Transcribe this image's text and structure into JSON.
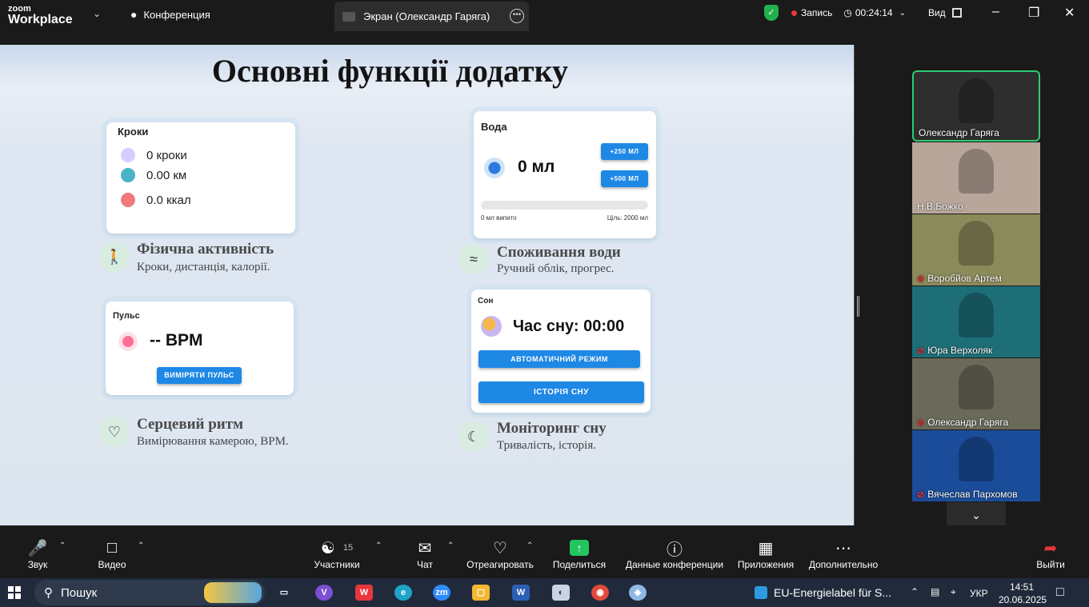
{
  "app": {
    "logo_top": "zoom",
    "logo_bottom": "Workplace"
  },
  "topbar": {
    "tab1": "Конференция",
    "tab2": "Экран (Олександр Гаряга)",
    "record_label": "Запись",
    "timer": "00:24:14",
    "view_label": "Вид"
  },
  "slide": {
    "title": "Основні функції додатку",
    "steps_card": {
      "title": "Кроки",
      "rows": [
        "0 кроки",
        "0.00 км",
        "0.0 ккал"
      ]
    },
    "water_card": {
      "title": "Вода",
      "amount": "0 мл",
      "btn1": "+250 МЛ",
      "btn2": "+500 МЛ",
      "drunk": "0 мл випито",
      "goal": "Ціль: 2000 мл",
      "progress": 0
    },
    "pulse_card": {
      "title": "Пульс",
      "bpm": "-- BPM",
      "button": "ВИМІРЯТИ ПУЛЬС"
    },
    "sleep_card": {
      "title": "Сон",
      "time": "Час сну: 00:00",
      "btn1": "АВТОМАТИЧНИЙ РЕЖИМ",
      "btn2": "ІСТОРІЯ СНУ"
    },
    "features": [
      {
        "title": "Фізична активність",
        "subtitle": "Кроки, дистанція, калорії."
      },
      {
        "title": "Споживання води",
        "subtitle": "Ручний облік, прогрес."
      },
      {
        "title": "Серцевий ритм",
        "subtitle": "Вимірювання камерою, BPM."
      },
      {
        "title": "Моніторинг сну",
        "subtitle": "Тривалість, історія."
      }
    ]
  },
  "participants": [
    {
      "name": "Олександр Гаряга",
      "muted": false,
      "active": true,
      "bg": "#2e2e2e"
    },
    {
      "name": "Н.В.Божко",
      "muted": false,
      "active": false,
      "bg": "#b8a69a"
    },
    {
      "name": "Воробйов Артем",
      "muted": true,
      "active": false,
      "bg": "#8a8a5a"
    },
    {
      "name": "Юра Верхоляк",
      "muted": true,
      "active": false,
      "bg": "#1e6e78"
    },
    {
      "name": "Олександр Гаряга",
      "muted": true,
      "active": false,
      "bg": "#6a6a5a"
    },
    {
      "name": "Вячеслав Пархомов",
      "muted": true,
      "active": false,
      "bg": "#1a4c9a"
    }
  ],
  "toolbar": {
    "audio": "Звук",
    "video": "Видео",
    "participants": "Участники",
    "participants_count": "15",
    "chat": "Чат",
    "react": "Отреагировать",
    "share": "Поделиться",
    "info": "Данные конференции",
    "apps": "Приложения",
    "more": "Дополнительно",
    "leave": "Выйти"
  },
  "taskbar": {
    "search": "Пошук",
    "notification": "EU-Energielabel für S...",
    "lang": "УКР",
    "time": "14:51",
    "date": "20.06.2025"
  },
  "colors": {
    "accent_blue": "#1e88e5",
    "share_green": "#22c55e",
    "record_red": "#e8363d",
    "active_border": "#2ecc71"
  }
}
